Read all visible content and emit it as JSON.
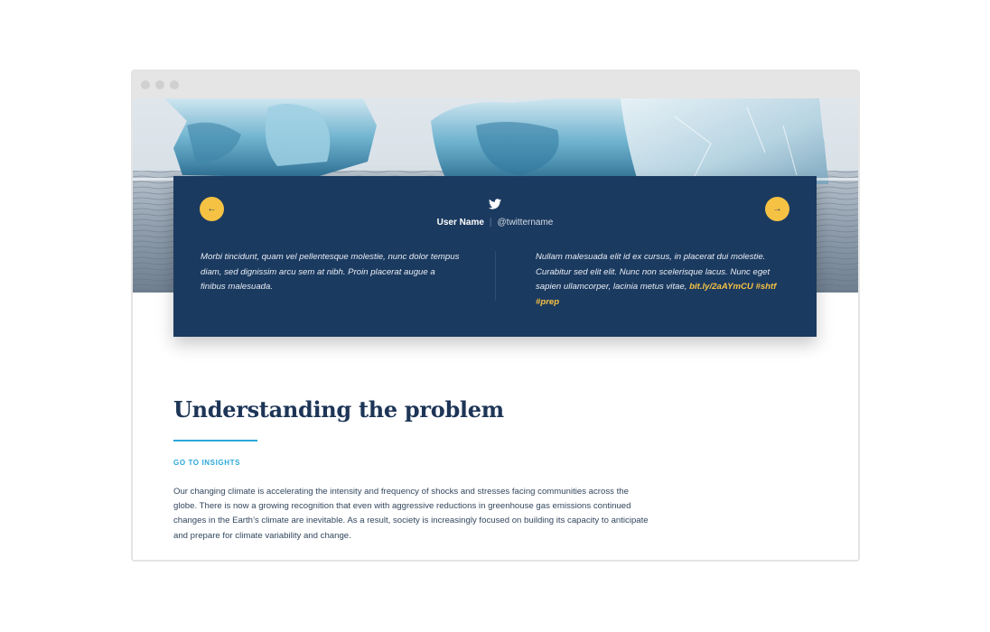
{
  "tweet": {
    "icon": "twitter-bird-icon",
    "user_name": "User Name",
    "separator": "|",
    "handle": "@twittername",
    "left_text": "Morbi tincidunt, quam vel pellentesque molestie, nunc dolor tempus diam, sed dignissim arcu sem at nibh. Proin placerat augue a finibus malesuada.",
    "right_text": "Nullam malesuada elit id ex cursus, in placerat dui molestie. Curabitur sed elit elit. Nunc non scelerisque lacus. Nunc eget sapien ullamcorper, lacinia metus vitae,",
    "right_link": "bit.ly/2aAYmCU #shtf #prep",
    "prev_icon": "arrow-left-icon",
    "next_icon": "arrow-right-icon"
  },
  "section": {
    "heading": "Understanding the problem",
    "link": "GO TO INSIGHTS",
    "body": "Our changing climate is accelerating the intensity and frequency of shocks and stresses facing communities across the globe. There is now a growing recognition that even with aggressive reductions in greenhouse gas emissions continued changes in the Earth’s climate are inevitable. As a result, society is increasingly focused on building its capacity to anticipate and prepare for climate variability and change."
  },
  "colors": {
    "card_bg": "#1b3a60",
    "accent_yellow": "#f5c243",
    "accent_blue": "#2aa8d8",
    "heading": "#1d3557"
  }
}
